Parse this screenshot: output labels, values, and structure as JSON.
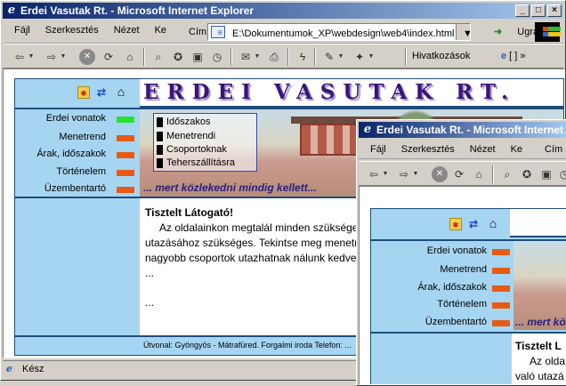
{
  "window1": {
    "title": "Erdei Vasutak Rt. - Microsoft Internet Explorer",
    "caption_buttons": [
      "_",
      "□",
      "×"
    ],
    "menu": [
      "Fájl",
      "Szerkesztés",
      "Nézet",
      "Ke"
    ],
    "address_label": "Cím",
    "address_value": "E:\\Dokumentumok_XP\\webdesign\\web4\\index.html",
    "go_label": "Ugrás",
    "links_label": "Hivatkozások",
    "status": "Kész"
  },
  "window2": {
    "title": "Erdei Vasutak Rt. - Microsoft Internet Explorer",
    "menu": [
      "Fájl",
      "Szerkesztés",
      "Nézet",
      "Ke"
    ],
    "address_label": "Cím"
  },
  "site": {
    "logo": "ERDEI VASUTAK RT.",
    "nav": [
      {
        "label": "Erdei vonatok",
        "active": true
      },
      {
        "label": "Menetrend",
        "active": false
      },
      {
        "label": "Árak, időszakok",
        "active": false
      },
      {
        "label": "Történelem",
        "active": false
      },
      {
        "label": "Üzembentartó",
        "active": false
      }
    ],
    "submenu": [
      "Időszakos",
      "Menetrendi",
      "Csoportoknak",
      "Teherszállításra"
    ],
    "slogan": "... mert közlekedni mindig kellett...",
    "greeting": "Tisztelt Látogató!",
    "paragraph": "Az oldalainkon megtalál minden szükséges információt, ami a kényelmes utazásához szükséges. Tekintse meg menetrendünket, valamint a kisebb és nagyobb csoportok utazhatnak nálunk kedvezményesen.",
    "ellipsis1": "...",
    "ellipsis2": "...",
    "footer": "Útvonal: Gyöngyös - Mátrafüred. Forgalmi iroda Telefon: ..."
  },
  "site2": {
    "nav": [
      "Erdei vonatok",
      "Menetrend",
      "Árak, időszakok",
      "Történelem",
      "Üzembentartó"
    ],
    "slogan": "... mert közl",
    "greeting": "Tisztelt L",
    "para_line1": "Az olda",
    "para_line2": "való utazá"
  },
  "colors": {
    "page_bg": "#a6d5f2",
    "border": "#1e4d7a",
    "nav_bar": "#e85a14",
    "nav_active": "#2ee02e",
    "logo_text": "#3a1478"
  },
  "icons": [
    "folder-star-icon",
    "refresh-icon",
    "home-icon"
  ]
}
